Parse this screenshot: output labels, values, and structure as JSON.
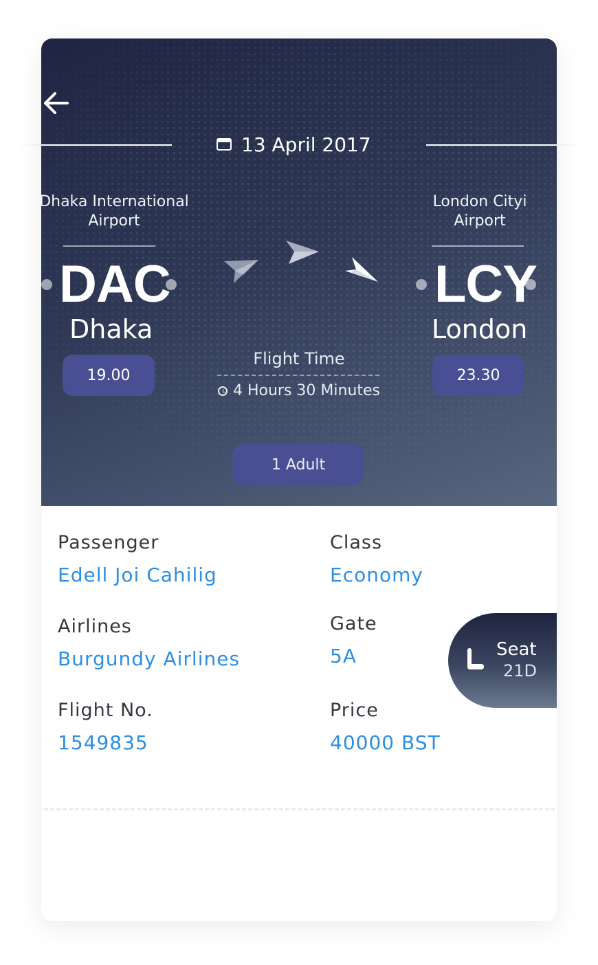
{
  "trip": {
    "date": "13 April 2017",
    "flight_time_label": "Flight Time",
    "duration": "4 Hours 30 Minutes",
    "passengers": "1 Adult"
  },
  "origin": {
    "airport_line1": "Dhaka International",
    "airport_line2": "Airport",
    "code": "DAC",
    "city": "Dhaka",
    "time": "19.00"
  },
  "destination": {
    "airport_line1": "London Cityi",
    "airport_line2": "Airport",
    "code": "LCY",
    "city": "London",
    "time": "23.30"
  },
  "details": {
    "passenger_label": "Passenger",
    "passenger": "Edell Joi Cahilig",
    "class_label": "Class",
    "class": "Economy",
    "airlines_label": "Airlines",
    "airlines": "Burgundy Airlines",
    "gate_label": "Gate",
    "gate": "5A",
    "flight_no_label": "Flight No.",
    "flight_no": "1549835",
    "price_label": "Price",
    "price": "40000 BST"
  },
  "seat": {
    "label": "Seat",
    "number": "21D"
  },
  "icons": [
    "back-arrow-icon",
    "calendar-icon",
    "paper-plane-icon",
    "clock-icon",
    "seat-icon"
  ],
  "colors": {
    "accent_value": "#2d8fe2",
    "pill": "#4a4e92",
    "hero_dark": "#1e2542",
    "hero_light": "#58667f"
  }
}
